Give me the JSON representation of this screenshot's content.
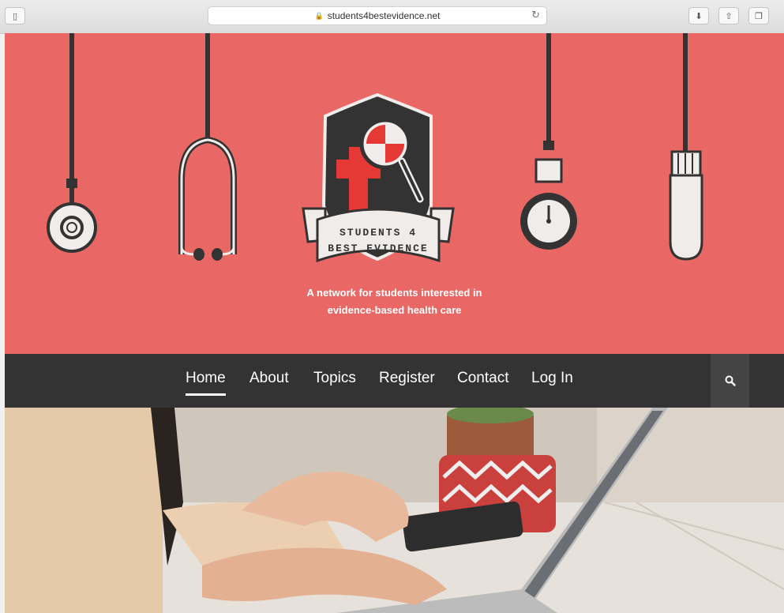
{
  "browser": {
    "url": "students4bestevidence.net",
    "icons": [
      "sidebar-icon",
      "reload-icon",
      "downloads-icon",
      "share-icon",
      "tabs-icon"
    ]
  },
  "hero": {
    "logo_line1": "STUDENTS 4",
    "logo_line2": "BEST EVIDENCE",
    "tagline_line1": "A network for students interested in",
    "tagline_line2": "evidence-based health care",
    "colors": {
      "background": "#e96765",
      "dark": "#333333",
      "light": "#f0ecea",
      "red": "#e53935"
    }
  },
  "nav": {
    "items": [
      {
        "label": "Home",
        "active": true
      },
      {
        "label": "About",
        "active": false
      },
      {
        "label": "Topics",
        "active": false
      },
      {
        "label": "Register",
        "active": false
      },
      {
        "label": "Contact",
        "active": false
      },
      {
        "label": "Log In",
        "active": false
      }
    ],
    "search_icon": "search-icon"
  }
}
